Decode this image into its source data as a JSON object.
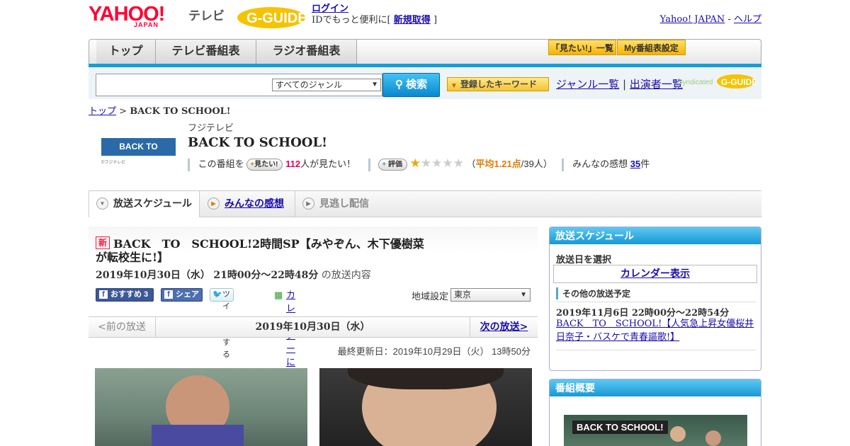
{
  "header": {
    "logo_main": "YAHOO!",
    "logo_sub": "JAPAN",
    "service": "テレビ",
    "gguide": "G-GUIDE",
    "login_label": "ログイン",
    "login_prefix": "IDでもっと便利に[",
    "signup_label": "新規取得",
    "login_suffix": "]",
    "yahoo_japan_link": "Yahoo! JAPAN",
    "link_sep": "-",
    "help_link": "ヘルプ"
  },
  "nav": {
    "tabs": [
      {
        "label": "トップ"
      },
      {
        "label": "テレビ番組表"
      },
      {
        "label": "ラジオ番組表"
      }
    ],
    "mitai_list": "「見たい!」一覧",
    "my_schedule": "My番組表設定"
  },
  "search": {
    "genre_selected": "すべてのジャンル",
    "search_button": "検索",
    "keyword_button": "登録したキーワード",
    "genre_list_link": "ジャンル一覧",
    "link_sep": "|",
    "cast_list_link": "出演者一覧",
    "syndicated": "Syndicated"
  },
  "breadcrumb": {
    "top": "トップ",
    "sep": ">",
    "current": "BACK TO SCHOOL!"
  },
  "program": {
    "thumb_text": "BACK TO SCHOOL!",
    "thumb_caption": "©フジテレビ",
    "station": "フジテレビ",
    "title": "BACK TO SCHOOL!",
    "want_prefix": "この番組を",
    "want_button": "見たい!",
    "want_count": "112",
    "want_suffix": "人が見たい！",
    "rate_button": "評価",
    "rating": 1.21,
    "rating_open": "（",
    "rating_avg": "平均1.21点",
    "rating_count": "/39人）",
    "impressions_label": "みんなの感想",
    "impressions_count": "35",
    "impressions_suffix": "件"
  },
  "tabs": [
    {
      "label": "放送スケジュール"
    },
    {
      "label": "みんなの感想"
    },
    {
      "label": "見逃し配信"
    }
  ],
  "episode": {
    "new_badge": "新",
    "title": "BACK　TO　SCHOOL!2時間SP【みやぞん、木下優樹菜が転校生に!】",
    "date": "2019年10月30日（水）",
    "time": "21時00分～22時48分",
    "date_suffix": "の放送内容",
    "share_fb": "おすすめ 3",
    "share_fb2": "シェア",
    "tweet": "ツイートする",
    "calendar_register": "カレンダーに登録",
    "region_label": "地域設定",
    "region_value": "東京",
    "prev_label": "<前の放送",
    "current_date": "2019年10月30日（水）",
    "next_label": "次の放送>",
    "updated": "最終更新日：2019年10月29日（火）  13時50分"
  },
  "sidebar": {
    "schedule_head": "放送スケジュール",
    "select_date": "放送日を選択",
    "calendar_button": "カレンダー表示",
    "other_label": "その他の放送予定",
    "other_date": "2019年11月6日  22時00分～22時54分",
    "other_title": "BACK　TO　SCHOOL!【人気急上昇女優桜井日奈子・バスケで青春謳歌!】",
    "summary_head": "番組概要",
    "summary_thumb_text": "BACK TO SCHOOL!"
  },
  "colors": {
    "yahoo_red": "#ff0033",
    "accent_blue": "#149ddb",
    "link": "#1a0dab",
    "pink": "#e3006c",
    "orange": "#e07b00"
  }
}
